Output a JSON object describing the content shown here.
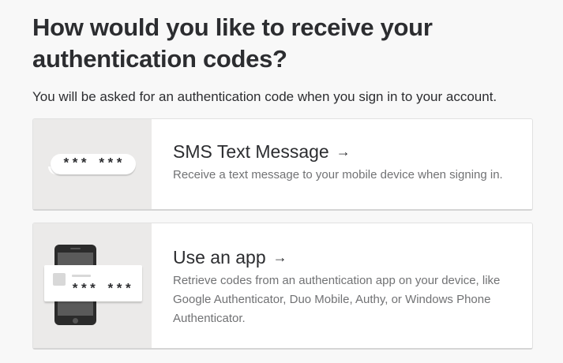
{
  "page": {
    "title": "How would you like to receive your authentication codes?",
    "subtitle": "You will be asked for an authentication code when you sign in to your account."
  },
  "options": [
    {
      "title": "SMS Text Message",
      "arrow": "→",
      "description": "Receive a text message to your mobile device when signing in.",
      "illustration_code": "*** ***",
      "icon": "sms-bubble-icon"
    },
    {
      "title": "Use an app",
      "arrow": "→",
      "description": "Retrieve codes from an authentication app on your device, like Google Authenticator, Duo Mobile, Authy, or Windows Phone Authenticator.",
      "illustration_code": "*** ***",
      "icon": "phone-app-icon"
    }
  ],
  "colors": {
    "background": "#f8f8f8",
    "card": "#ffffff",
    "illustration_bg": "#ebeae9",
    "text_primary": "#2c2d30",
    "text_secondary": "#717274"
  }
}
